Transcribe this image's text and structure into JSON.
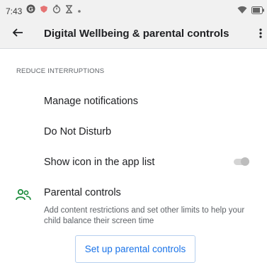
{
  "status_bar": {
    "time": "7:43",
    "left_icons": [
      "google-icon",
      "shield-icon",
      "timer-icon",
      "hourglass-icon",
      "dot-icon"
    ],
    "right_icons": [
      "wifi-icon",
      "battery-icon"
    ]
  },
  "app_bar": {
    "back_icon": "arrow-left-icon",
    "title": "Digital Wellbeing & parental controls",
    "overflow_icon": "more-vert-icon"
  },
  "section_reduce": {
    "header": "REDUCE INTERRUPTIONS",
    "items": [
      {
        "label": "Manage notifications"
      },
      {
        "label": "Do Not Disturb"
      },
      {
        "label": "Show icon in the app list",
        "toggle": false
      }
    ]
  },
  "parental": {
    "icon": "people-icon",
    "title": "Parental controls",
    "description": "Add content restrictions and set other limits to help your child balance their screen time",
    "button_label": "Set up parental controls"
  },
  "colors": {
    "accent": "#1a73e8",
    "parental_icon": "#1e8e3e",
    "status_bar_bg": "#f1f1f1"
  }
}
